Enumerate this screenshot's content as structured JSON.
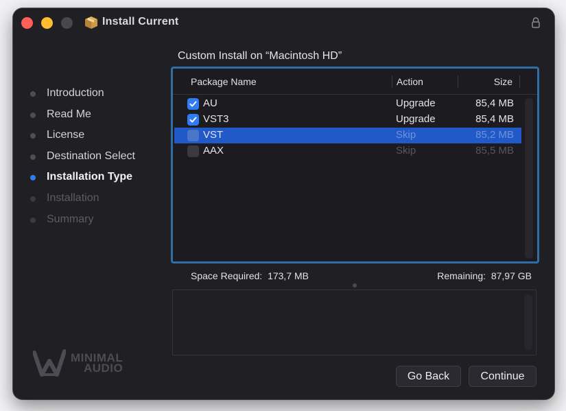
{
  "window": {
    "title": "Install Current",
    "app_icon": "package-icon",
    "lock_icon": "lock-icon"
  },
  "steps": [
    {
      "label": "Introduction",
      "state": "done"
    },
    {
      "label": "Read Me",
      "state": "done"
    },
    {
      "label": "License",
      "state": "done"
    },
    {
      "label": "Destination Select",
      "state": "done"
    },
    {
      "label": "Installation Type",
      "state": "current"
    },
    {
      "label": "Installation",
      "state": "future"
    },
    {
      "label": "Summary",
      "state": "future"
    }
  ],
  "heading": "Custom Install on “Macintosh HD”",
  "table": {
    "headers": {
      "name": "Package Name",
      "action": "Action",
      "size": "Size"
    },
    "rows": [
      {
        "name": "AU",
        "action": "Upgrade",
        "size": "85,4 MB",
        "checked": true
      },
      {
        "name": "VST3",
        "action": "Upgrade",
        "size": "85,4 MB",
        "checked": true
      },
      {
        "name": "VST",
        "action": "Skip",
        "size": "85,2 MB",
        "checked": false,
        "selected": true
      },
      {
        "name": "AAX",
        "action": "Skip",
        "size": "85,5 MB",
        "checked": false
      }
    ]
  },
  "space": {
    "required_label": "Space Required:",
    "required_value": "173,7 MB",
    "remaining_label": "Remaining:",
    "remaining_value": "87,97 GB"
  },
  "logo": {
    "line1": "MINIMAL",
    "line2": "AUDIO"
  },
  "buttons": {
    "back": "Go Back",
    "continue": "Continue"
  },
  "colors": {
    "accent": "#2f7cf6",
    "selection": "#2159c8",
    "focus_ring": "#2f6fa8"
  }
}
